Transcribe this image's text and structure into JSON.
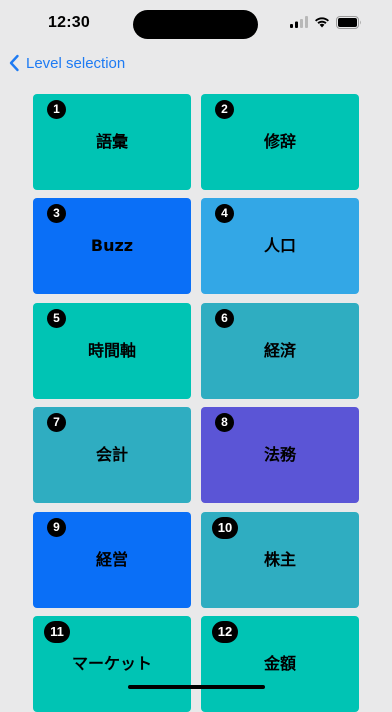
{
  "status_bar": {
    "time": "12:30",
    "icons": [
      "signal-icon",
      "wifi-icon",
      "battery-icon"
    ]
  },
  "nav": {
    "back_label": "Level selection",
    "back_icon": "chevron-left-icon",
    "accent_color": "#1e7bf3"
  },
  "levels": [
    {
      "number": "1",
      "label": "語彙",
      "color": "#00c4b4"
    },
    {
      "number": "2",
      "label": "修辞",
      "color": "#00c4b4"
    },
    {
      "number": "3",
      "label": "Buzz",
      "color": "#0a6ff7"
    },
    {
      "number": "4",
      "label": "人口",
      "color": "#33a7e6"
    },
    {
      "number": "5",
      "label": "時間軸",
      "color": "#00c4b4"
    },
    {
      "number": "6",
      "label": "経済",
      "color": "#2fadc1"
    },
    {
      "number": "7",
      "label": "会計",
      "color": "#2fadc1"
    },
    {
      "number": "8",
      "label": "法務",
      "color": "#5b55d6"
    },
    {
      "number": "9",
      "label": "経営",
      "color": "#0a6ff7"
    },
    {
      "number": "10",
      "label": "株主",
      "color": "#2fadc1"
    },
    {
      "number": "11",
      "label": "マーケット",
      "color": "#00c4b4"
    },
    {
      "number": "12",
      "label": "金額",
      "color": "#00c4b4"
    }
  ]
}
